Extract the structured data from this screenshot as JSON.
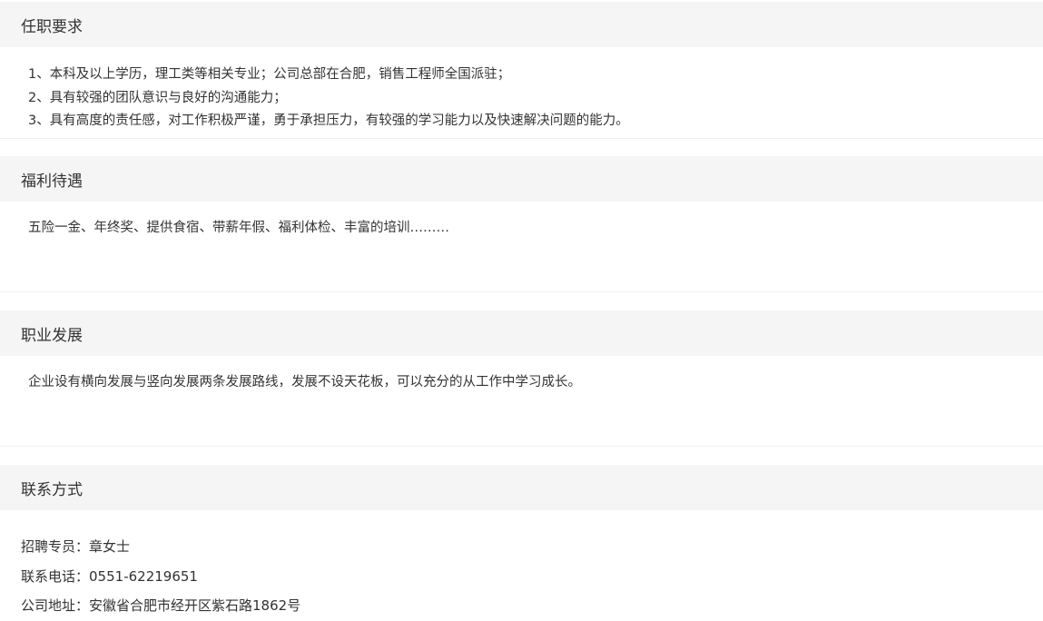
{
  "requirements": {
    "title": "任职要求",
    "items": [
      "1、本科及以上学历，理工类等相关专业；公司总部在合肥，销售工程师全国派驻；",
      "2、具有较强的团队意识与良好的沟通能力；",
      "3、具有高度的责任感，对工作积极严谨，勇于承担压力，有较强的学习能力以及快速解决问题的能力。"
    ]
  },
  "benefits": {
    "title": "福利待遇",
    "text": "五险一金、年终奖、提供食宿、带薪年假、福利体检、丰富的培训………"
  },
  "career": {
    "title": "职业发展",
    "text": "企业设有横向发展与竖向发展两条发展路线，发展不设天花板，可以充分的从工作中学习成长。"
  },
  "contact": {
    "title": "联系方式",
    "recruiter_label": "招聘专员：",
    "recruiter_value": "章女士",
    "phone_label": "联系电话：",
    "phone_value": "0551-62219651",
    "address_label": "公司地址：",
    "address_value": "安徽省合肥市经开区紫石路1862号"
  }
}
